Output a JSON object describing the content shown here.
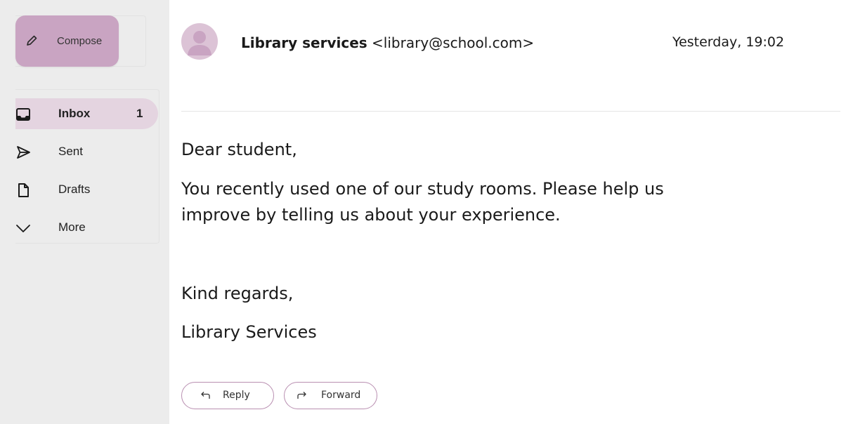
{
  "sidebar": {
    "compose_label": "Compose",
    "items": [
      {
        "label": "Inbox",
        "count": "1",
        "icon": "inbox-icon",
        "active": true
      },
      {
        "label": "Sent",
        "icon": "send-icon"
      },
      {
        "label": "Drafts",
        "icon": "draft-icon"
      },
      {
        "label": "More",
        "icon": "chevron-down-icon"
      }
    ]
  },
  "message": {
    "sender_name": "Library services",
    "sender_email": "<library@school.com>",
    "date": "Yesterday, 19:02",
    "greeting": "Dear student,",
    "body_line1": "You recently used one of our study rooms. Please help us",
    "body_line2": "improve by telling us about your experience.",
    "closing": "Kind regards,",
    "signature": "Library Services"
  },
  "actions": {
    "reply_label": "Reply",
    "forward_label": "Forward"
  },
  "colors": {
    "accent": "#c9a4c2",
    "active_nav": "#e4d4e0",
    "avatar": "#dcc3d6",
    "sidebar_bg": "#ececec"
  }
}
